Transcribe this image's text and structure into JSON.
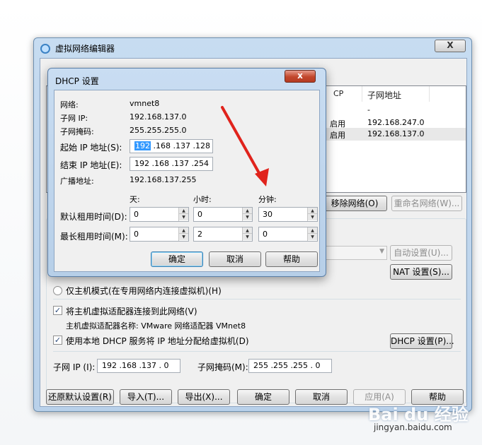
{
  "main_window": {
    "title": "虚拟网络编辑器",
    "close": "X",
    "columns": [
      "CP",
      "子网地址"
    ],
    "rows": [
      {
        "dhcp": "",
        "subnet": "-"
      },
      {
        "dhcp": "启用",
        "subnet": "192.168.247.0"
      },
      {
        "dhcp": "启用",
        "subnet": "192.168.137.0"
      }
    ],
    "remove_network": "移除网络(O)",
    "rename_network": "重命名网络(W)...",
    "auto_settings": "自动设置(U)...",
    "nat_settings": "NAT 设置(S)...",
    "host_only_label": "仅主机模式(在专用网络内连接虚拟机)(H)",
    "connect_adapter_label": "将主机虚拟适配器连接到此网络(V)",
    "adapter_name_label": "主机虚拟适配器名称: VMware 网络适配器 VMnet8",
    "use_dhcp_label": "使用本地 DHCP 服务将 IP 地址分配给虚拟机(D)",
    "dhcp_settings": "DHCP 设置(P)...",
    "subnet_ip_label": "子网 IP (I):",
    "subnet_ip_value": "192 .168 .137 . 0",
    "subnet_mask_label": "子网掩码(M):",
    "subnet_mask_value": "255 .255 .255 . 0",
    "buttons": {
      "restore": "还原默认设置(R)",
      "import": "导入(T)...",
      "export": "导出(X)...",
      "ok": "确定",
      "cancel": "取消",
      "apply": "应用(A)",
      "help": "帮助"
    }
  },
  "dhcp_dialog": {
    "title": "DHCP 设置",
    "close": "x",
    "network_label": "网络:",
    "network_value": "vmnet8",
    "subnet_ip_label": "子网 IP:",
    "subnet_ip_value": "192.168.137.0",
    "subnet_mask_label": "子网掩码:",
    "subnet_mask_value": "255.255.255.0",
    "start_ip_label": "起始 IP 地址(S):",
    "start_ip_first": "192",
    "start_ip_rest": " .168 .137 .128",
    "end_ip_label": "结束 IP 地址(E):",
    "end_ip_value": "192 .168 .137 .254",
    "broadcast_label": "广播地址:",
    "broadcast_value": "192.168.137.255",
    "col_days": "天:",
    "col_hours": "小时:",
    "col_minutes": "分钟:",
    "default_lease_label": "默认租用时间(D):",
    "default_lease": {
      "days": "0",
      "hours": "0",
      "minutes": "30"
    },
    "max_lease_label": "最长租用时间(M):",
    "max_lease": {
      "days": "0",
      "hours": "2",
      "minutes": "0"
    },
    "ok": "确定",
    "cancel": "取消",
    "help": "帮助"
  },
  "watermark": {
    "logo": "Bai du 经验",
    "url": "jingyan.baidu.com"
  },
  "colors": {
    "accent_arrow": "#e0231c",
    "selection": "#3399ff"
  }
}
